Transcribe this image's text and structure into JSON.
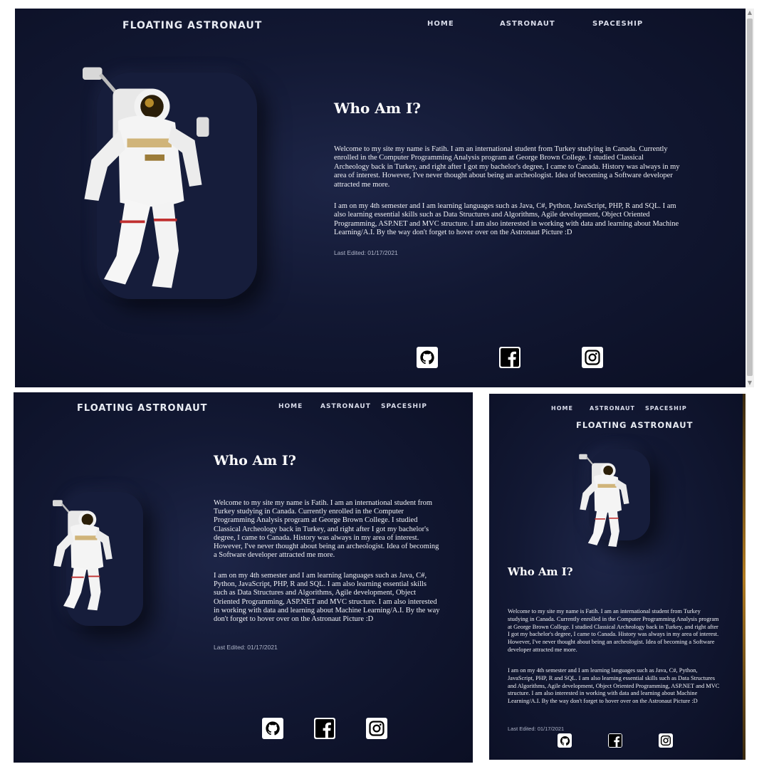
{
  "brand": "FLOATING ASTRONAUT",
  "nav": {
    "home": "HOME",
    "astronaut": "ASTRONAUT",
    "spaceship": "SPACESHIP"
  },
  "heading": "Who Am I?",
  "paragraph1": "Welcome to my site my name is Fatih. I am an international student from Turkey studying in Canada. Currently enrolled in the Computer Programming Analysis program at George Brown College. I studied Classical Archeology back in Turkey, and right after I got my bachelor's degree, I came to Canada. History was always in my area of interest. However, I've never thought about being an archeologist. Idea of becoming a Software developer attracted me more.",
  "paragraph2": "I am on my 4th semester and I am learning languages such as Java, C#, Python, JavaScript, PHP, R and SQL. I am also learning essential skills such as Data Structures and Algorithms, Agile development, Object Oriented Programming, ASP.NET and MVC structure. I am also interested in working with data and learning about Machine Learning/A.I. By the way don't forget to hover over on the Astronaut Picture :D",
  "last_edited": "Last Edited: 01/17/2021",
  "social": [
    "github-icon",
    "facebook-icon",
    "instagram-icon"
  ],
  "colors": {
    "background": "#121833",
    "card": "#161d3b",
    "text": "#ffffff"
  }
}
